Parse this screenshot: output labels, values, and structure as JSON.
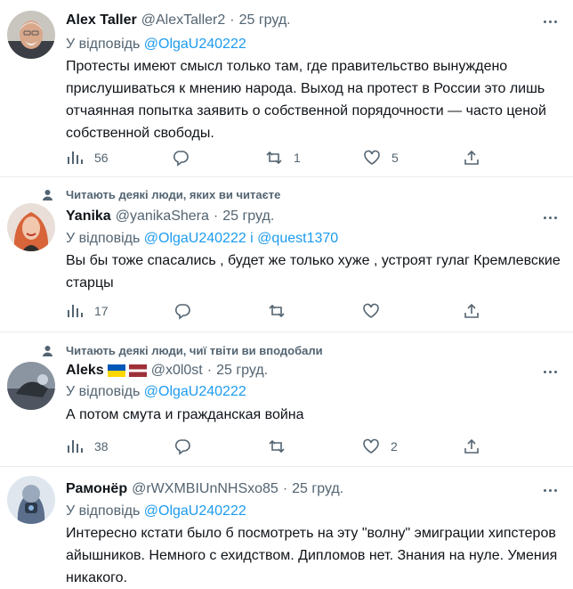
{
  "tweets": [
    {
      "name": "Alex Taller",
      "handle": "@AlexTaller2",
      "dot": "·",
      "time": "25 груд.",
      "reply_prefix": "У відповідь",
      "reply_mentions": "@OlgaU240222",
      "text": "Протесты имеют смысл только там, где правительство вынуждено прислушиваться к мнению народа. Выход на протест в России это лишь отчаянная попытка заявить о собственной порядочности — часто ценой собственной свободы.",
      "views": "56",
      "retweets": "1",
      "likes": "5"
    },
    {
      "social_context": "Читають деякі люди, яких ви читаєте",
      "name": "Yanika",
      "handle": "@yanikaShera",
      "dot": "·",
      "time": "25 груд.",
      "reply_prefix": "У відповідь",
      "reply_mentions": "@OlgaU240222 і @quest1370",
      "text": "Вы бы тоже спасались , будет же только хуже , устроят гулаг Кремлевские старцы",
      "views": "17"
    },
    {
      "social_context": "Читають деякі люди, чиї твіти ви вподобали",
      "name": "Aleks",
      "handle": "@x0l0st",
      "dot": "·",
      "time": "25 груд.",
      "reply_prefix": "У відповідь",
      "reply_mentions": "@OlgaU240222",
      "text": "А потом смута и гражданская война",
      "views": "38",
      "likes": "2"
    },
    {
      "name": "Рамонёр",
      "handle": "@rWXMBIUnNHSxo85",
      "dot": "·",
      "time": "25 груд.",
      "reply_prefix": "У відповідь",
      "reply_mentions": "@OlgaU240222",
      "text": "Интересно кстати было б посмотреть на эту \"волну\" эмиграции хипстеров айышников. Немного с ехидством. Дипломов нет. Знания на нуле. Умения никакого."
    }
  ],
  "colors": {
    "accent": "#1d9bf0",
    "secondary_text": "#536471",
    "separator": "#e6ecf0"
  },
  "icons": [
    "views-icon",
    "reply-icon",
    "retweet-icon",
    "like-icon",
    "share-icon",
    "more-icon",
    "person-icon",
    "ukraine-flag-icon",
    "latvia-flag-icon"
  ]
}
